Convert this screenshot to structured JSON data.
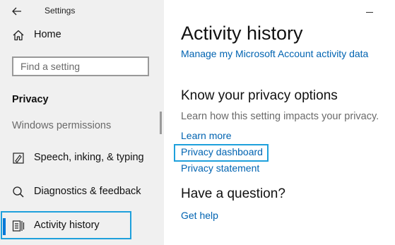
{
  "window": {
    "title": "Settings"
  },
  "sidebar": {
    "home_label": "Home",
    "search_placeholder": "Find a setting",
    "section_heading": "Privacy",
    "subsection_label": "Windows permissions",
    "items": [
      {
        "label": "Speech, inking, & typing",
        "icon": "speech-inking-icon"
      },
      {
        "label": "Diagnostics & feedback",
        "icon": "diagnostics-icon"
      },
      {
        "label": "Activity history",
        "icon": "activity-history-icon",
        "active": true
      }
    ]
  },
  "main": {
    "title": "Activity history",
    "manage_link": "Manage my Microsoft Account activity data",
    "privacy_heading": "Know your privacy options",
    "privacy_description": "Learn how this setting impacts your privacy.",
    "links": {
      "learn_more": "Learn more",
      "privacy_dashboard": "Privacy dashboard",
      "privacy_statement": "Privacy statement"
    },
    "question_heading": "Have a question?",
    "get_help": "Get help"
  },
  "colors": {
    "sidebar_bg": "#f0f0f0",
    "link": "#0063b1",
    "accent": "#0078d7",
    "highlight": "#1ea0dc"
  }
}
